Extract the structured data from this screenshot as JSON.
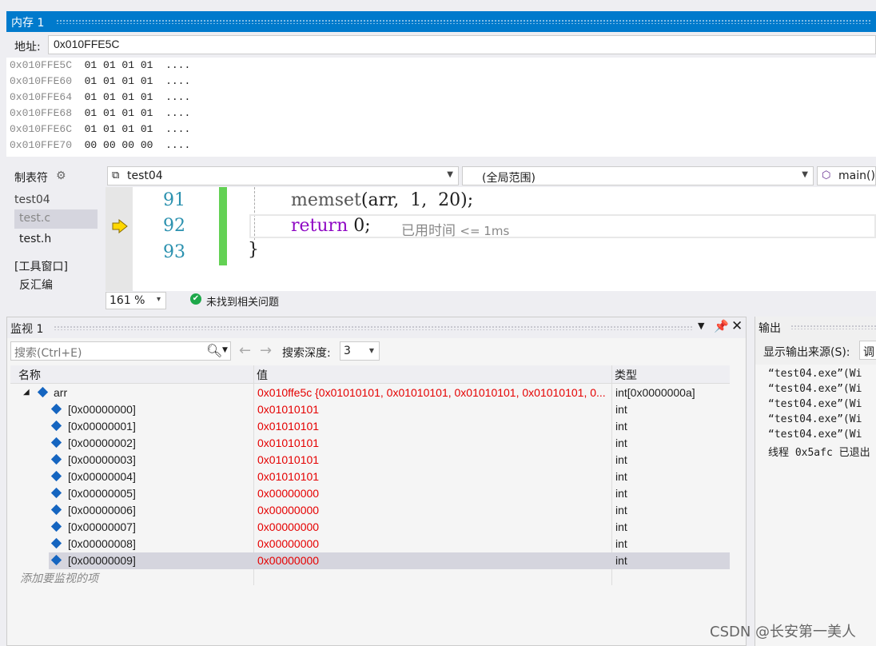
{
  "memory": {
    "title": "内存 1",
    "address_label": "地址:",
    "address_value": "0x010FFE5C",
    "rows": [
      {
        "addr": "0x010FFE5C",
        "bytes": "01 01 01 01",
        "ascii": "...."
      },
      {
        "addr": "0x010FFE60",
        "bytes": "01 01 01 01",
        "ascii": "...."
      },
      {
        "addr": "0x010FFE64",
        "bytes": "01 01 01 01",
        "ascii": "...."
      },
      {
        "addr": "0x010FFE68",
        "bytes": "01 01 01 01",
        "ascii": "...."
      },
      {
        "addr": "0x010FFE6C",
        "bytes": "01 01 01 01",
        "ascii": "...."
      },
      {
        "addr": "0x010FFE70",
        "bytes": "00 00 00 00",
        "ascii": "...."
      }
    ]
  },
  "sidebar": {
    "title": "制表符",
    "project": "test04",
    "files": [
      "test.c",
      "test.h"
    ],
    "tool_window": "[工具窗口]",
    "disassembly": "反汇编"
  },
  "nav": {
    "file": "test04",
    "scope": "(全局范围)",
    "function": "main()"
  },
  "editor": {
    "lines": [
      {
        "num": "91",
        "code_fn": "memset",
        "code_rest": "(arr,  1,  20);"
      },
      {
        "num": "92",
        "code_kw": "return",
        "code_rest": " 0;",
        "elapsed_label": "已用时间",
        "elapsed_value": "<= 1ms"
      },
      {
        "num": "93",
        "code_rest": "}"
      }
    ]
  },
  "status": {
    "zoom": "161 %",
    "issues": "未找到相关问题"
  },
  "watch": {
    "title": "监视 1",
    "search_placeholder": "搜索(Ctrl+E)",
    "depth_label": "搜索深度:",
    "depth_value": "3",
    "columns": {
      "name": "名称",
      "value": "值",
      "type": "类型"
    },
    "root": {
      "name": "arr",
      "value": "0x010ffe5c {0x01010101, 0x01010101, 0x01010101, 0x01010101, 0...",
      "type": "int[0x0000000a]"
    },
    "items": [
      {
        "name": "[0x00000000]",
        "value": "0x01010101",
        "type": "int"
      },
      {
        "name": "[0x00000001]",
        "value": "0x01010101",
        "type": "int"
      },
      {
        "name": "[0x00000002]",
        "value": "0x01010101",
        "type": "int"
      },
      {
        "name": "[0x00000003]",
        "value": "0x01010101",
        "type": "int"
      },
      {
        "name": "[0x00000004]",
        "value": "0x01010101",
        "type": "int"
      },
      {
        "name": "[0x00000005]",
        "value": "0x00000000",
        "type": "int"
      },
      {
        "name": "[0x00000006]",
        "value": "0x00000000",
        "type": "int"
      },
      {
        "name": "[0x00000007]",
        "value": "0x00000000",
        "type": "int"
      },
      {
        "name": "[0x00000008]",
        "value": "0x00000000",
        "type": "int"
      },
      {
        "name": "[0x00000009]",
        "value": "0x00000000",
        "type": "int"
      }
    ],
    "add_item": "添加要监视的项"
  },
  "output": {
    "title": "输出",
    "source_label": "显示输出来源(S):",
    "source_value": "调",
    "lines": [
      "“test04.exe”(Wi",
      "“test04.exe”(Wi",
      "“test04.exe”(Wi",
      "“test04.exe”(Wi",
      "“test04.exe”(Wi",
      "线程 0x5afc 已退出"
    ]
  },
  "watermark": "CSDN @长安第一美人",
  "colors": {
    "accent": "#007acc",
    "changed_value": "#e50000",
    "line_number": "#2b91af",
    "keyword": "#8f08c4",
    "changed_bar": "#63d154"
  }
}
